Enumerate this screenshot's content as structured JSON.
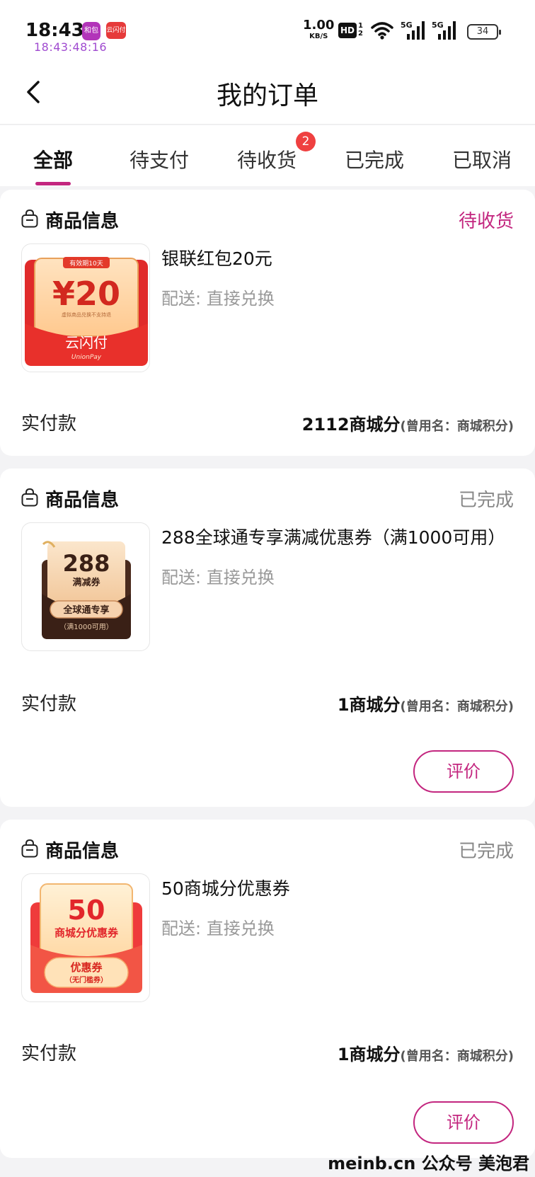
{
  "status_bar": {
    "time": "18:43",
    "clock_sub": "18:43:48:16",
    "app1_label": "和包",
    "app2_label": "云闪付",
    "net_speed": "1.00",
    "net_unit": "KB/S",
    "hd": "HD",
    "hd_sub_top": "1",
    "hd_sub_bottom": "2",
    "sig1": "5G",
    "sig2": "5G",
    "battery": "34"
  },
  "header": {
    "title": "我的订单"
  },
  "tabs": [
    {
      "label": "全部",
      "active": true
    },
    {
      "label": "待支付"
    },
    {
      "label": "待收货",
      "badge": "2"
    },
    {
      "label": "已完成"
    },
    {
      "label": "已取消"
    }
  ],
  "orders": [
    {
      "section_label": "商品信息",
      "status": "待收货",
      "product_name": "银联红包20元",
      "delivery": "配送: 直接兑换",
      "pay_label": "实付款",
      "pay_amount": "2112商城分",
      "pay_note": "(曾用名：商城积分)",
      "thumb": {
        "validity": "有效期10天",
        "amount": "¥20",
        "note": "虚拟商品兑换不支持退",
        "brand": "云闪付",
        "brand_en": "UnionPay"
      }
    },
    {
      "section_label": "商品信息",
      "status": "已完成",
      "product_name": "288全球通专享满减优惠券（满1000可用）",
      "delivery": "配送: 直接兑换",
      "pay_label": "实付款",
      "pay_amount": "1商城分",
      "pay_note": "(曾用名：商城积分)",
      "review_label": "评价",
      "thumb": {
        "amount": "288",
        "type": "满减券",
        "pill": "全球通专享",
        "cond": "（满1000可用）"
      }
    },
    {
      "section_label": "商品信息",
      "status": "已完成",
      "product_name": "50商城分优惠券",
      "delivery": "配送: 直接兑换",
      "pay_label": "实付款",
      "pay_amount": "1商城分",
      "pay_note": "(曾用名：商城积分)",
      "review_label": "评价",
      "thumb": {
        "amount": "50",
        "type": "商城分优惠券",
        "pill": "优惠券",
        "pill_sub": "（无门槛券）"
      }
    }
  ],
  "watermark": "meinb.cn  公众号 美泡君",
  "colors": {
    "accent": "#c3267f",
    "badge": "#ef4040",
    "page_bg": "#f3f3f5"
  }
}
